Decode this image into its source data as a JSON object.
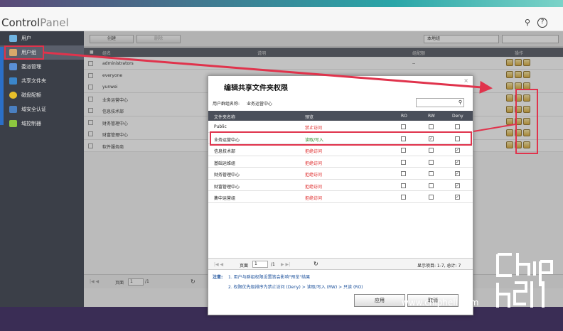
{
  "app": {
    "title_bold": "Control",
    "title_light": "Panel"
  },
  "sidebar": {
    "items": [
      {
        "label": "用户",
        "color": "#6fb3e0"
      },
      {
        "label": "用户组",
        "color": "#d8a96a"
      },
      {
        "label": "委派管理",
        "color": "#5a8fd6"
      },
      {
        "label": "共享文件夹",
        "color": "#3b86c9"
      },
      {
        "label": "磁盘配额",
        "color": "#e8c02a"
      },
      {
        "label": "域安全认证",
        "color": "#4a7fc0"
      },
      {
        "label": "域控制器",
        "color": "#8dc63f"
      }
    ]
  },
  "toolbar": {
    "create_label": "创建",
    "delete_label": "删除",
    "filter_value": "本地组"
  },
  "table": {
    "headers": {
      "name": "组名",
      "desc": "说明",
      "domain": "组配额",
      "ops": "操作"
    },
    "rows": [
      {
        "name": "administrators",
        "domain": "--"
      },
      {
        "name": "everyone",
        "domain": ""
      },
      {
        "name": "yunwei",
        "domain": ""
      },
      {
        "name": "业务运营中心",
        "domain": ""
      },
      {
        "name": "信息技术部",
        "domain": ""
      },
      {
        "name": "财务管理中心",
        "domain": ""
      },
      {
        "name": "财富管理中心",
        "domain": ""
      },
      {
        "name": "软件服务商",
        "domain": ""
      }
    ],
    "pager": {
      "page_label": "页面",
      "page": "1",
      "total": "/1"
    }
  },
  "dialog": {
    "title": "编辑共享文件夹权限",
    "close": "×",
    "group_label": "用户群组名称:",
    "group_value": "业务运营中心",
    "headers": {
      "name": "文件夹名称",
      "preview": "预览",
      "ro": "RO",
      "rw": "RW",
      "deny": "Deny"
    },
    "rows": [
      {
        "name": "Public",
        "perm": "禁止访问",
        "perm_type": "deny",
        "ro": false,
        "rw": false,
        "deny": false
      },
      {
        "name": "业务运营中心",
        "perm": "读取/写入",
        "perm_type": "rw",
        "ro": false,
        "rw": true,
        "deny": false
      },
      {
        "name": "信息技术部",
        "perm": "拒绝访问",
        "perm_type": "deny",
        "ro": false,
        "rw": false,
        "deny": true
      },
      {
        "name": "基础运维组",
        "perm": "拒绝访问",
        "perm_type": "deny",
        "ro": false,
        "rw": false,
        "deny": true
      },
      {
        "name": "财务管理中心",
        "perm": "拒绝访问",
        "perm_type": "deny",
        "ro": false,
        "rw": false,
        "deny": true
      },
      {
        "name": "财富管理中心",
        "perm": "拒绝访问",
        "perm_type": "deny",
        "ro": false,
        "rw": false,
        "deny": true
      },
      {
        "name": "集中运营组",
        "perm": "拒绝访问",
        "perm_type": "deny",
        "ro": false,
        "rw": false,
        "deny": true
      }
    ],
    "pager": {
      "page_label": "页面",
      "page": "1",
      "total": "/1",
      "status": "显示项目: 1-7, 总计: 7"
    },
    "note_label": "注意:",
    "note1": "1. 用户与群组权限设置皆会影响\"预览\"结果",
    "note2": "2. 权限优先级排序为禁止访问 (Deny) > 读取/写入 (RW) > 只读 (RO)",
    "apply_label": "应用",
    "cancel_label": "取消"
  },
  "watermark": "www.chiphell.com",
  "logo_text": "chip hell",
  "accent_red": "#e0334c"
}
